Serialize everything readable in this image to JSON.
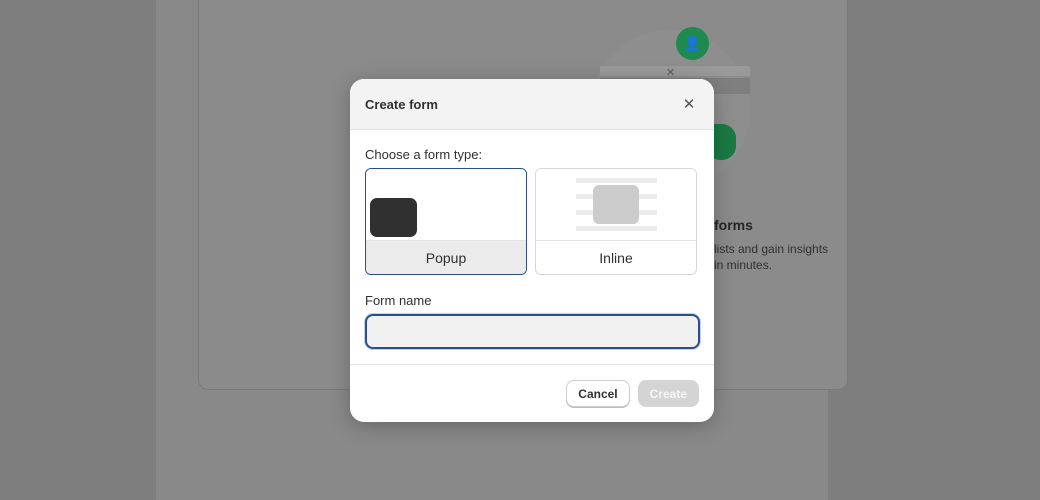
{
  "background": {
    "heading": "forms",
    "line1": "lists and gain insights",
    "line2": "in minutes.",
    "illustration_icons": [
      "add-person-icon",
      "close-icon",
      "leaf-icon"
    ]
  },
  "modal": {
    "title": "Create form",
    "close_icon": "close-icon",
    "type_label": "Choose a form type:",
    "types": [
      {
        "label": "Popup",
        "selected": true
      },
      {
        "label": "Inline",
        "selected": false
      }
    ],
    "name_label": "Form name",
    "name_value": "",
    "name_placeholder": "",
    "cancel_label": "Cancel",
    "create_label": "Create"
  },
  "colors": {
    "accent_focus": "#2b4f8a",
    "disabled_button": "#d4d4d4",
    "avatar_green": "#1f8a4e"
  }
}
